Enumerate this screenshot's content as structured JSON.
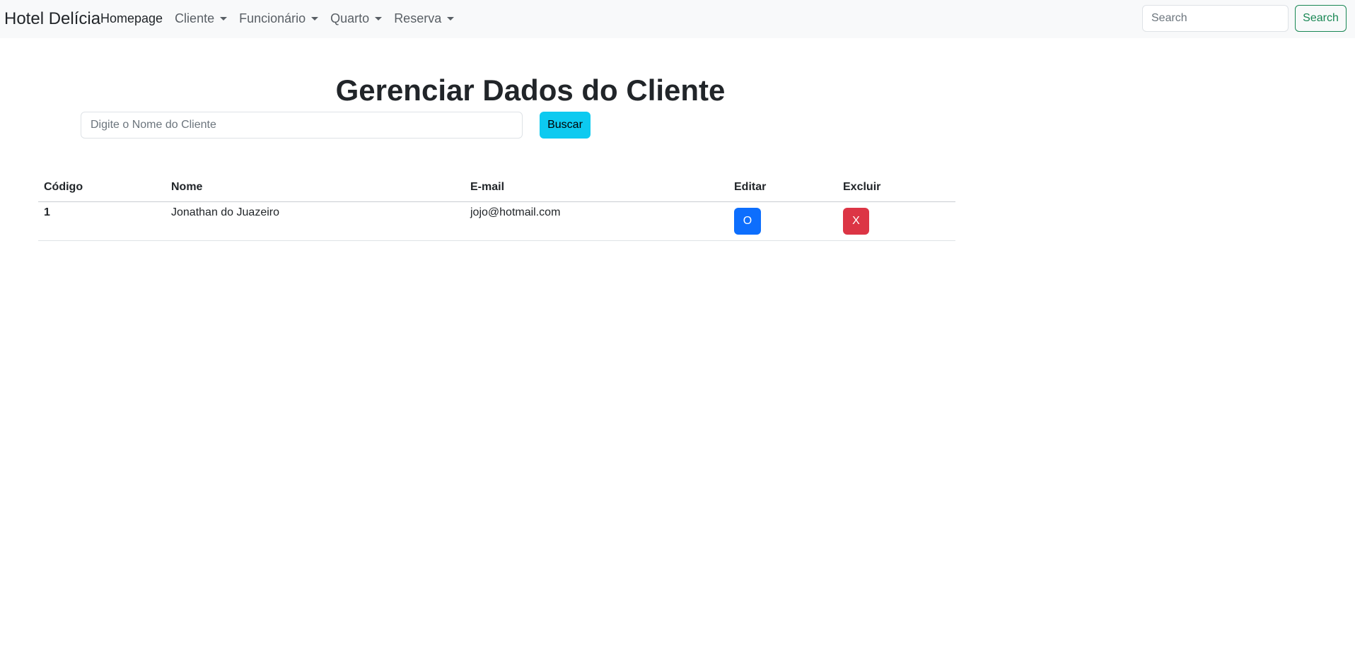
{
  "navbar": {
    "brand": "Hotel Delícia",
    "items": [
      {
        "label": "Homepage",
        "dropdown": false,
        "active": true
      },
      {
        "label": "Cliente",
        "dropdown": true,
        "active": false
      },
      {
        "label": "Funcionário",
        "dropdown": true,
        "active": false
      },
      {
        "label": "Quarto",
        "dropdown": true,
        "active": false
      },
      {
        "label": "Reserva",
        "dropdown": true,
        "active": false
      }
    ],
    "search_placeholder": "Search",
    "search_button": "Search"
  },
  "main": {
    "title": "Gerenciar Dados do Cliente",
    "search_placeholder": "Digite o Nome do Cliente",
    "search_button": "Buscar"
  },
  "table": {
    "headers": [
      "Código",
      "Nome",
      "E-mail",
      "Editar",
      "Excluir"
    ],
    "rows": [
      {
        "codigo": "1",
        "nome": "Jonathan do Juazeiro",
        "email": "jojo@hotmail.com",
        "editar": "O",
        "excluir": "X"
      }
    ]
  },
  "colors": {
    "navbar_bg": "#f8f9fa",
    "search_btn": "#198754",
    "buscar_btn": "#0dcaf0",
    "editar_btn": "#0d6efd",
    "excluir_btn": "#dc3545"
  }
}
